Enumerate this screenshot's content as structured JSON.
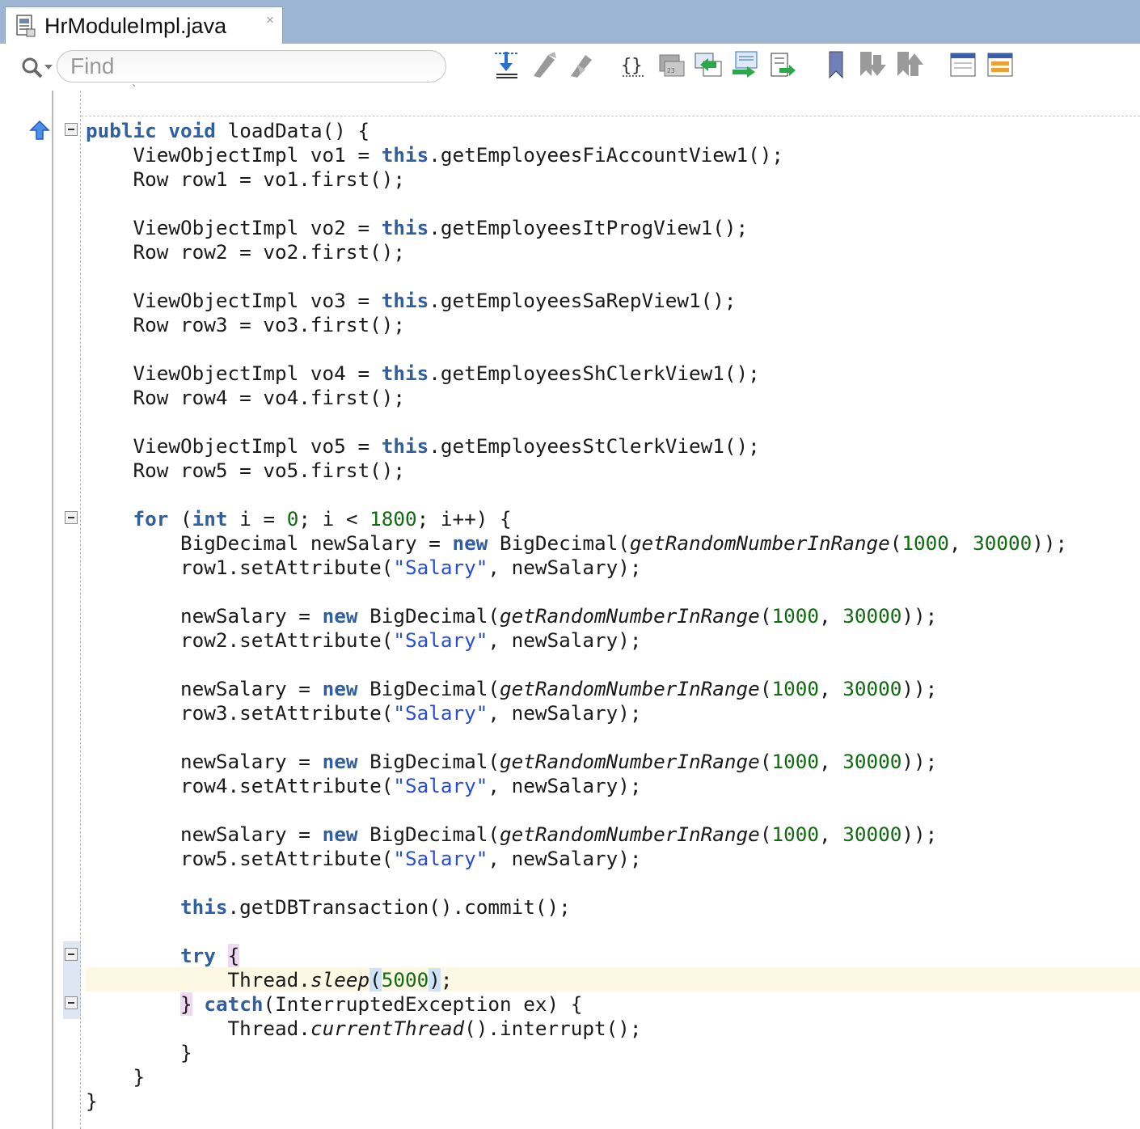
{
  "window": {
    "tab_title": "HrModuleImpl.java",
    "tab_close": "×"
  },
  "toolbar": {
    "find_placeholder": "Find",
    "icons": [
      "search-icon",
      "toggle-scroll-icon",
      "previous-change-icon",
      "next-change-icon",
      "braces-icon",
      "db-tool-icon",
      "compare-icon",
      "forward-icon",
      "export-icon",
      "bookmark-icon",
      "next-bookmark-icon",
      "previous-bookmark-icon",
      "split-window-icon",
      "template-icon"
    ]
  },
  "editor": {
    "top_stub": "`",
    "lines": [
      "public void loadData() {",
      "    ViewObjectImpl vo1 = this.getEmployeesFiAccountView1();",
      "    Row row1 = vo1.first();",
      "",
      "    ViewObjectImpl vo2 = this.getEmployeesItProgView1();",
      "    Row row2 = vo2.first();",
      "",
      "    ViewObjectImpl vo3 = this.getEmployeesSaRepView1();",
      "    Row row3 = vo3.first();",
      "",
      "    ViewObjectImpl vo4 = this.getEmployeesShClerkView1();",
      "    Row row4 = vo4.first();",
      "",
      "    ViewObjectImpl vo5 = this.getEmployeesStClerkView1();",
      "    Row row5 = vo5.first();",
      "",
      "    for (int i = 0; i < 1800; i++) {",
      "        BigDecimal newSalary = new BigDecimal(getRandomNumberInRange(1000, 30000));",
      "        row1.setAttribute(\"Salary\", newSalary);",
      "",
      "        newSalary = new BigDecimal(getRandomNumberInRange(1000, 30000));",
      "        row2.setAttribute(\"Salary\", newSalary);",
      "",
      "        newSalary = new BigDecimal(getRandomNumberInRange(1000, 30000));",
      "        row3.setAttribute(\"Salary\", newSalary);",
      "",
      "        newSalary = new BigDecimal(getRandomNumberInRange(1000, 30000));",
      "        row4.setAttribute(\"Salary\", newSalary);",
      "",
      "        newSalary = new BigDecimal(getRandomNumberInRange(1000, 30000));",
      "        row5.setAttribute(\"Salary\", newSalary);",
      "",
      "        this.getDBTransaction().commit();",
      "",
      "        try {",
      "            Thread.sleep(5000);",
      "        } catch(InterruptedException ex) {",
      "            Thread.currentThread().interrupt();",
      "        }",
      "    }",
      "}"
    ],
    "current_line": 36,
    "folds_at_lines": [
      1,
      17,
      35,
      37
    ]
  },
  "colors": {
    "keyword": "#2f5f9e",
    "number": "#106b10",
    "string": "#2a4ed0",
    "current_line_bg": "#fdf8e4",
    "tab_bar_bg": "#9db4d2"
  }
}
